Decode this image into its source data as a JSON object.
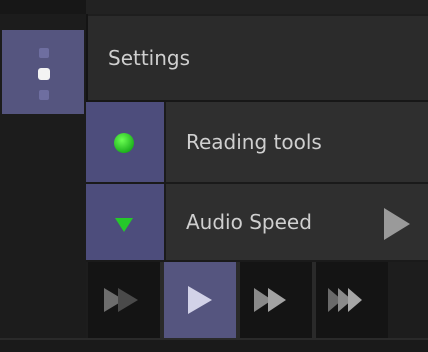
{
  "settings": {
    "label": "Settings",
    "icon": "menu-dots-icon"
  },
  "reading_tools": {
    "label": "Reading tools",
    "icon": "green-dot-icon",
    "color": "#2fd02f"
  },
  "audio_speed": {
    "label": "Audio Speed",
    "icon": "green-triangle-down-icon"
  },
  "speed_buttons": [
    {
      "name": "speed-slow-button",
      "icon": "double-chevron-faded-icon",
      "selected": false
    },
    {
      "name": "speed-normal-button",
      "icon": "play-icon",
      "selected": true
    },
    {
      "name": "speed-fast-button",
      "icon": "fast-forward-icon",
      "selected": false
    },
    {
      "name": "speed-faster-button",
      "icon": "triple-forward-icon",
      "selected": false
    }
  ],
  "colors": {
    "accent": "#55557f",
    "panel": "#2f2f2f",
    "background": "#1e1e1e"
  }
}
